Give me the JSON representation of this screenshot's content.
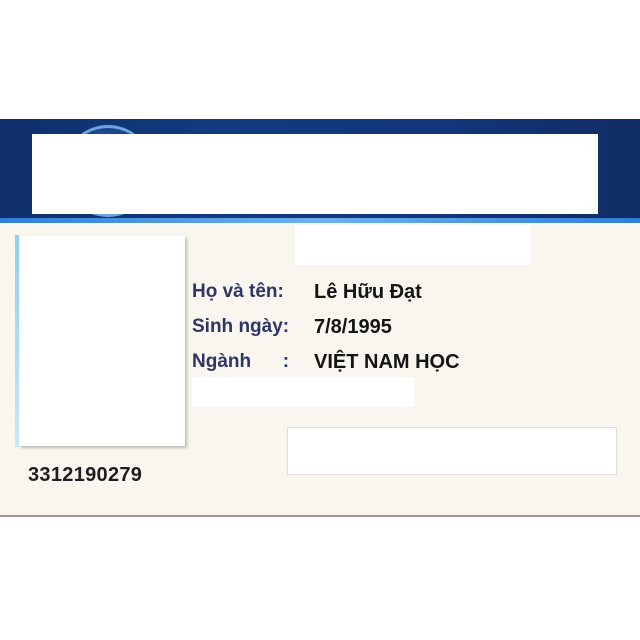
{
  "card": {
    "fields": {
      "name": {
        "label": "Họ và tên:",
        "value": "Lê Hữu Đạt"
      },
      "dob": {
        "label": "Sinh ngày:",
        "value": "7/8/1995"
      },
      "major": {
        "label": "Ngành      :",
        "value": "VIỆT NAM HỌC"
      }
    },
    "id_number": "3312190279"
  }
}
